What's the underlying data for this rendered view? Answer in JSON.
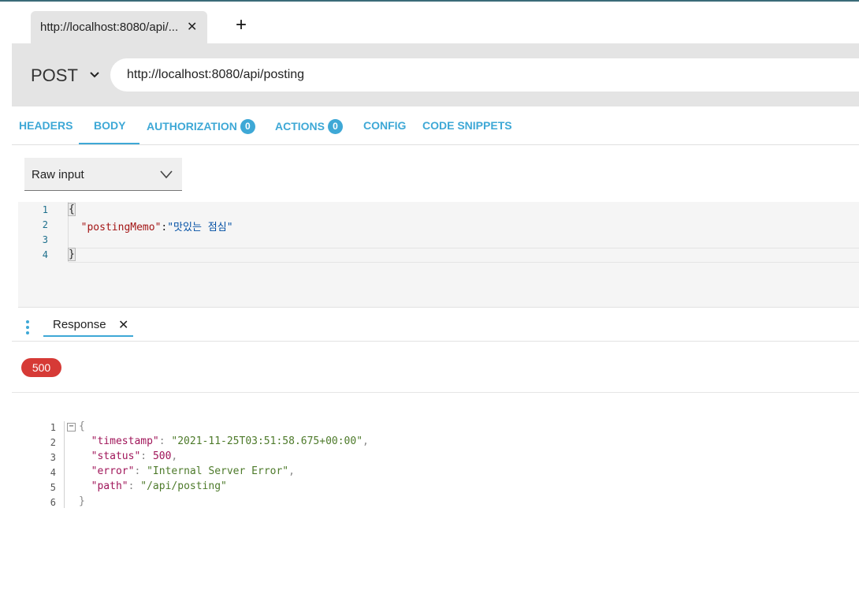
{
  "browser_tab": {
    "title": "http://localhost:8080/api/...",
    "close_glyph": "✕",
    "new_tab_glyph": "+"
  },
  "request": {
    "method": "POST",
    "url": "http://localhost:8080/api/posting"
  },
  "request_tabs": [
    {
      "label": "HEADERS",
      "active": false
    },
    {
      "label": "BODY",
      "active": true
    },
    {
      "label": "AUTHORIZATION",
      "badge": "0",
      "active": false
    },
    {
      "label": "ACTIONS",
      "badge": "0",
      "active": false
    },
    {
      "label": "CONFIG",
      "active": false
    },
    {
      "label": "CODE SNIPPETS",
      "active": false
    }
  ],
  "body_type": {
    "selected": "Raw input"
  },
  "request_editor": {
    "line_numbers": [
      "1",
      "2",
      "3",
      "4"
    ],
    "open_brace": "{",
    "key": "\"postingMemo\"",
    "colon": ":",
    "value": "\"맛있는 점심\"",
    "close_brace": "}"
  },
  "response": {
    "tab_label": "Response",
    "tab_close_glyph": "✕",
    "status_code": "500",
    "line_numbers": [
      "1",
      "2",
      "3",
      "4",
      "5",
      "6"
    ],
    "fold_glyph": "−",
    "open_brace": "{",
    "close_brace": "}",
    "fields": [
      {
        "key": "\"timestamp\"",
        "value": "\"2021-11-25T03:51:58.675+00:00\"",
        "sep": ","
      },
      {
        "key": "\"status\"",
        "value": "500",
        "sep": ","
      },
      {
        "key": "\"error\"",
        "value": "\"Internal Server Error\"",
        "sep": ","
      },
      {
        "key": "\"path\"",
        "value": "\"/api/posting\"",
        "sep": ""
      }
    ]
  },
  "colors": {
    "accent": "#3ea8d6",
    "error_badge": "#d63a36"
  }
}
